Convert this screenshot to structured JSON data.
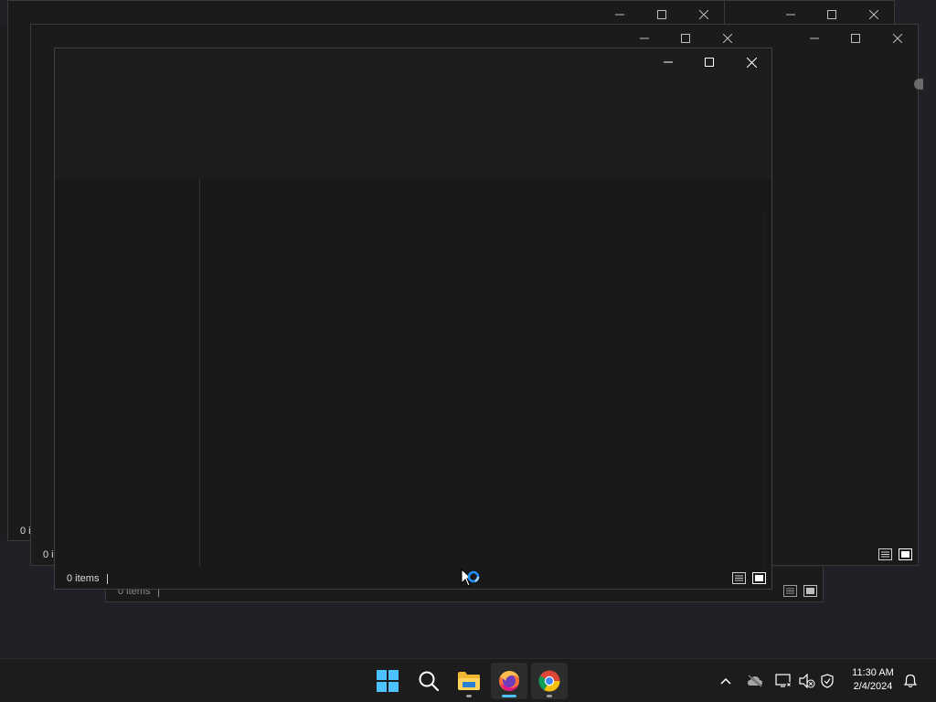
{
  "desktop": {
    "background_color": "#202026"
  },
  "windows": {
    "back_status_count": "0 i",
    "middle_status_count": "0 i",
    "bottom_status_count": "0 items",
    "front_status_count": "0 items"
  },
  "taskbar": {
    "apps": [
      {
        "name": "Start",
        "icon": "windows-logo-icon"
      },
      {
        "name": "Search",
        "icon": "search-icon"
      },
      {
        "name": "File Explorer",
        "icon": "folder-icon"
      },
      {
        "name": "Firefox",
        "icon": "firefox-icon"
      },
      {
        "name": "Chrome",
        "icon": "chrome-icon"
      }
    ],
    "tray": {
      "icons": [
        "chevron-up-icon",
        "cloud-offline-icon",
        "network-icon",
        "volume-muted-icon",
        "shield-warning-icon",
        "notification-bell-icon"
      ]
    },
    "clock": {
      "time": "11:30 AM",
      "date": "2/4/2024"
    }
  },
  "colors": {
    "accent": "#4cc2ff",
    "window_bg": "#191919",
    "taskbar_bg": "#1c1c1c"
  }
}
